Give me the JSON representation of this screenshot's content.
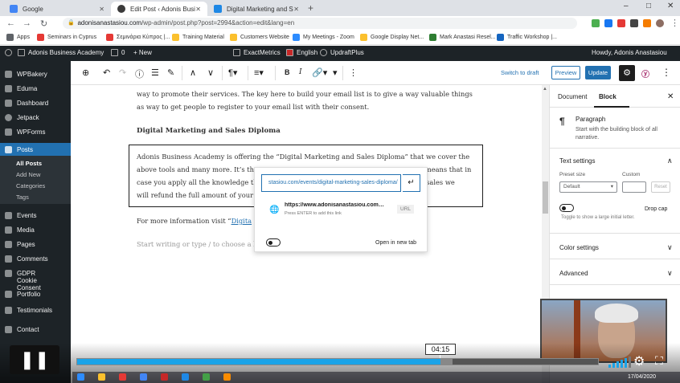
{
  "browser": {
    "tabs": [
      {
        "label": "Google",
        "color": "#4285f4"
      },
      {
        "label": "Edit Post ‹ Adonis Business Acad",
        "color": "#3a3a3a"
      },
      {
        "label": "Digital Marketing and Sales Diplo",
        "color": "#1e88e5"
      }
    ],
    "new_tab": "+",
    "window_controls": [
      "–",
      "□",
      "✕"
    ],
    "url_domain": "adonisanastasiou.com",
    "url_path": "/wp-admin/post.php?post=2994&action=edit&lang=en",
    "bookmarks": [
      {
        "label": "Apps",
        "color": "#5f6368"
      },
      {
        "label": "Seminars in Cyprus",
        "color": "#e53935"
      },
      {
        "label": "Σεμινάρια Κύπρος |...",
        "color": "#e53935"
      },
      {
        "label": "Training Material",
        "color": "#fbc02d"
      },
      {
        "label": "Customers Website",
        "color": "#fbc02d"
      },
      {
        "label": "My Meetings - Zoom",
        "color": "#2d8cff"
      },
      {
        "label": "Google Display Net...",
        "color": "#fbc02d"
      },
      {
        "label": "Mark Anastasi Resel...",
        "color": "#2e7d32"
      },
      {
        "label": "Traffic Workshop |...",
        "color": "#1565c0"
      }
    ]
  },
  "adminbar": {
    "site": "Adonis Business Academy",
    "comments": "0",
    "new": "New",
    "exactmetrics": "ExactMetrics",
    "language": "English",
    "updraft": "UpdraftPlus",
    "howdy": "Howdy, Adonis Anastasiou"
  },
  "sidebar": {
    "items": [
      {
        "label": "WPBakery",
        "active": false
      },
      {
        "label": "Eduma",
        "active": false
      },
      {
        "label": "Dashboard",
        "active": false
      },
      {
        "label": "Jetpack",
        "active": false
      },
      {
        "label": "WPForms",
        "active": false
      },
      {
        "label": "Posts",
        "active": true
      }
    ],
    "sub": [
      "All Posts",
      "Add New",
      "Categories",
      "Tags"
    ],
    "items2": [
      "Events",
      "Media",
      "Pages",
      "Comments",
      "GDPR Cookie Consent",
      "Portfolio",
      "Testimonials",
      "Contact"
    ]
  },
  "toolbar": {
    "switch_draft": "Switch to draft",
    "preview": "Preview",
    "update": "Update"
  },
  "content": {
    "para1": "way to promote their services. The key here to build your email list is to give a way valuable things as way to get people to register to your email list with their consent.",
    "heading": "Digital Marketing and Sales Diploma",
    "para2_l1": "Adonis Business Academy is offering the “Digital Marketing and Sales Diploma” that we cover the",
    "para2_l2a": "above tools and many more. It’s the",
    "para2_l2b": "means that in",
    "para2_l3a": "case you apply all the knowledge th",
    "para2_l3b": "e sales we",
    "para2_l4": "will refund the full amount of your",
    "more_info": "For more information visit  “",
    "more_link": "Digita",
    "placeholder": "Start writing or type / to choose a b"
  },
  "popover": {
    "input_value": "stasiou.com/events/digital-marketing-sales-diploma/",
    "suggestion_title": "https://www.adonisanastasiou.com/events/digital-marketing-sales-diploma/",
    "suggestion_hint": "Press ENTER to add this link",
    "suggestion_type": "URL",
    "new_tab_label": "Open in new tab"
  },
  "panel": {
    "tab_document": "Document",
    "tab_block": "Block",
    "block_name": "Paragraph",
    "block_desc": "Start with the building block of all narrative.",
    "text_settings": "Text settings",
    "preset_size": "Preset size",
    "custom": "Custom",
    "default": "Default",
    "reset": "Reset",
    "drop_cap": "Drop cap",
    "drop_desc": "Toggle to show a large initial letter.",
    "color_settings": "Color settings",
    "advanced": "Advanced"
  },
  "video": {
    "time": "04:15",
    "progress": 0.697,
    "buffered": 0.72,
    "clock": "17/04/2020"
  }
}
